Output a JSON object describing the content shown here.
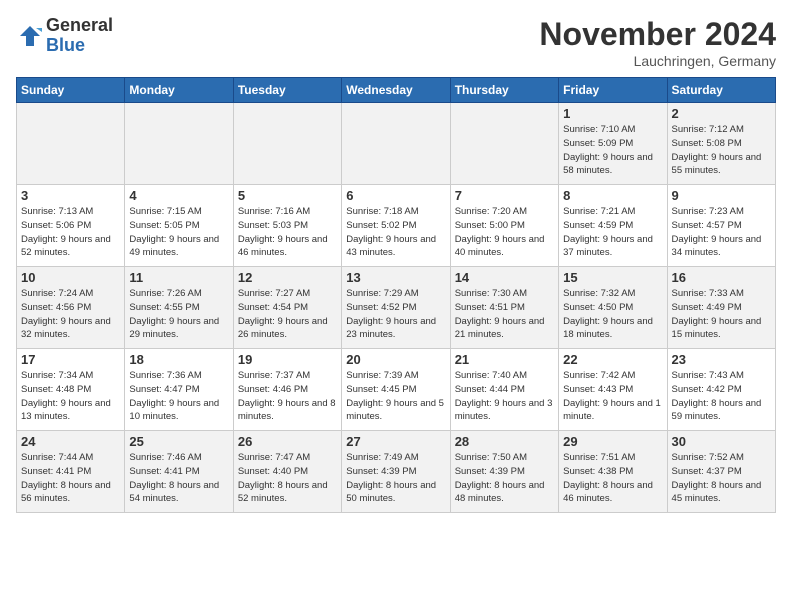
{
  "logo": {
    "general": "General",
    "blue": "Blue"
  },
  "title": "November 2024",
  "location": "Lauchringen, Germany",
  "weekdays": [
    "Sunday",
    "Monday",
    "Tuesday",
    "Wednesday",
    "Thursday",
    "Friday",
    "Saturday"
  ],
  "weeks": [
    [
      {
        "day": "",
        "info": ""
      },
      {
        "day": "",
        "info": ""
      },
      {
        "day": "",
        "info": ""
      },
      {
        "day": "",
        "info": ""
      },
      {
        "day": "",
        "info": ""
      },
      {
        "day": "1",
        "info": "Sunrise: 7:10 AM\nSunset: 5:09 PM\nDaylight: 9 hours and 58 minutes."
      },
      {
        "day": "2",
        "info": "Sunrise: 7:12 AM\nSunset: 5:08 PM\nDaylight: 9 hours and 55 minutes."
      }
    ],
    [
      {
        "day": "3",
        "info": "Sunrise: 7:13 AM\nSunset: 5:06 PM\nDaylight: 9 hours and 52 minutes."
      },
      {
        "day": "4",
        "info": "Sunrise: 7:15 AM\nSunset: 5:05 PM\nDaylight: 9 hours and 49 minutes."
      },
      {
        "day": "5",
        "info": "Sunrise: 7:16 AM\nSunset: 5:03 PM\nDaylight: 9 hours and 46 minutes."
      },
      {
        "day": "6",
        "info": "Sunrise: 7:18 AM\nSunset: 5:02 PM\nDaylight: 9 hours and 43 minutes."
      },
      {
        "day": "7",
        "info": "Sunrise: 7:20 AM\nSunset: 5:00 PM\nDaylight: 9 hours and 40 minutes."
      },
      {
        "day": "8",
        "info": "Sunrise: 7:21 AM\nSunset: 4:59 PM\nDaylight: 9 hours and 37 minutes."
      },
      {
        "day": "9",
        "info": "Sunrise: 7:23 AM\nSunset: 4:57 PM\nDaylight: 9 hours and 34 minutes."
      }
    ],
    [
      {
        "day": "10",
        "info": "Sunrise: 7:24 AM\nSunset: 4:56 PM\nDaylight: 9 hours and 32 minutes."
      },
      {
        "day": "11",
        "info": "Sunrise: 7:26 AM\nSunset: 4:55 PM\nDaylight: 9 hours and 29 minutes."
      },
      {
        "day": "12",
        "info": "Sunrise: 7:27 AM\nSunset: 4:54 PM\nDaylight: 9 hours and 26 minutes."
      },
      {
        "day": "13",
        "info": "Sunrise: 7:29 AM\nSunset: 4:52 PM\nDaylight: 9 hours and 23 minutes."
      },
      {
        "day": "14",
        "info": "Sunrise: 7:30 AM\nSunset: 4:51 PM\nDaylight: 9 hours and 21 minutes."
      },
      {
        "day": "15",
        "info": "Sunrise: 7:32 AM\nSunset: 4:50 PM\nDaylight: 9 hours and 18 minutes."
      },
      {
        "day": "16",
        "info": "Sunrise: 7:33 AM\nSunset: 4:49 PM\nDaylight: 9 hours and 15 minutes."
      }
    ],
    [
      {
        "day": "17",
        "info": "Sunrise: 7:34 AM\nSunset: 4:48 PM\nDaylight: 9 hours and 13 minutes."
      },
      {
        "day": "18",
        "info": "Sunrise: 7:36 AM\nSunset: 4:47 PM\nDaylight: 9 hours and 10 minutes."
      },
      {
        "day": "19",
        "info": "Sunrise: 7:37 AM\nSunset: 4:46 PM\nDaylight: 9 hours and 8 minutes."
      },
      {
        "day": "20",
        "info": "Sunrise: 7:39 AM\nSunset: 4:45 PM\nDaylight: 9 hours and 5 minutes."
      },
      {
        "day": "21",
        "info": "Sunrise: 7:40 AM\nSunset: 4:44 PM\nDaylight: 9 hours and 3 minutes."
      },
      {
        "day": "22",
        "info": "Sunrise: 7:42 AM\nSunset: 4:43 PM\nDaylight: 9 hours and 1 minute."
      },
      {
        "day": "23",
        "info": "Sunrise: 7:43 AM\nSunset: 4:42 PM\nDaylight: 8 hours and 59 minutes."
      }
    ],
    [
      {
        "day": "24",
        "info": "Sunrise: 7:44 AM\nSunset: 4:41 PM\nDaylight: 8 hours and 56 minutes."
      },
      {
        "day": "25",
        "info": "Sunrise: 7:46 AM\nSunset: 4:41 PM\nDaylight: 8 hours and 54 minutes."
      },
      {
        "day": "26",
        "info": "Sunrise: 7:47 AM\nSunset: 4:40 PM\nDaylight: 8 hours and 52 minutes."
      },
      {
        "day": "27",
        "info": "Sunrise: 7:49 AM\nSunset: 4:39 PM\nDaylight: 8 hours and 50 minutes."
      },
      {
        "day": "28",
        "info": "Sunrise: 7:50 AM\nSunset: 4:39 PM\nDaylight: 8 hours and 48 minutes."
      },
      {
        "day": "29",
        "info": "Sunrise: 7:51 AM\nSunset: 4:38 PM\nDaylight: 8 hours and 46 minutes."
      },
      {
        "day": "30",
        "info": "Sunrise: 7:52 AM\nSunset: 4:37 PM\nDaylight: 8 hours and 45 minutes."
      }
    ]
  ]
}
